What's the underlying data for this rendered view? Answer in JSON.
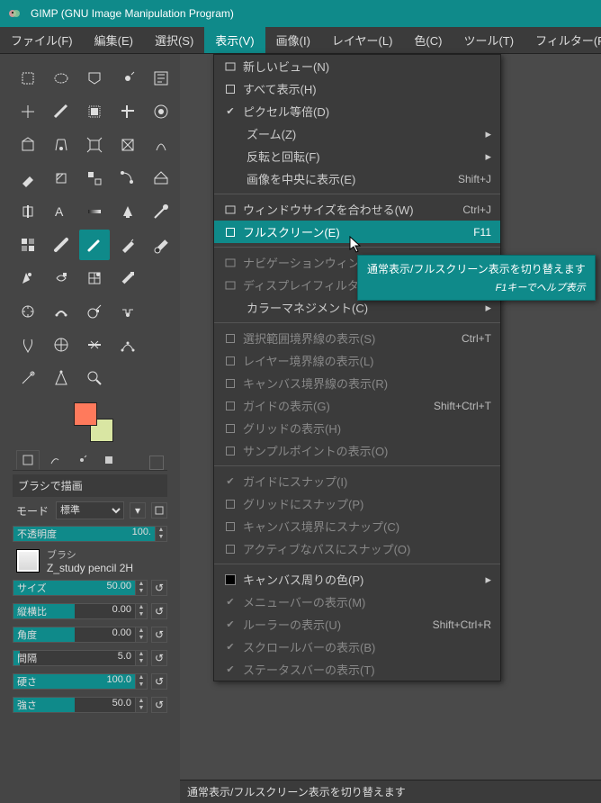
{
  "titlebar": {
    "title": "GIMP (GNU Image Manipulation Program)"
  },
  "menubar": {
    "items": [
      {
        "label": "ファイル(F)"
      },
      {
        "label": "編集(E)"
      },
      {
        "label": "選択(S)"
      },
      {
        "label": "表示(V)",
        "active": true
      },
      {
        "label": "画像(I)"
      },
      {
        "label": "レイヤー(L)"
      },
      {
        "label": "色(C)"
      },
      {
        "label": "ツール(T)"
      },
      {
        "label": "フィルター(R)"
      }
    ]
  },
  "view_menu": [
    {
      "t": "item",
      "label": "新しいビュー(N)",
      "icon": "window"
    },
    {
      "t": "item",
      "label": "すべて表示(H)",
      "chk": false
    },
    {
      "t": "item",
      "label": "ピクセル等倍(D)",
      "chk": true
    },
    {
      "t": "item",
      "label": "ズーム(Z)",
      "sub": true,
      "indent": true
    },
    {
      "t": "item",
      "label": "反転と回転(F)",
      "sub": true,
      "indent": true
    },
    {
      "t": "item",
      "label": "画像を中央に表示(E)",
      "accel": "Shift+J",
      "indent": true
    },
    {
      "t": "sep"
    },
    {
      "t": "item",
      "label": "ウィンドウサイズを合わせる(W)",
      "accel": "Ctrl+J",
      "icon": "window"
    },
    {
      "t": "item",
      "label": "フルスクリーン(E)",
      "accel": "F11",
      "chk": false,
      "highlight": true
    },
    {
      "t": "sep"
    },
    {
      "t": "item",
      "label": "ナビゲーションウィンドウ(V)",
      "icon": "compass",
      "dim": true
    },
    {
      "t": "item",
      "label": "ディスプレイフィルター(D)...",
      "icon": "filter",
      "dim": true
    },
    {
      "t": "item",
      "label": "カラーマネジメント(C)",
      "sub": true,
      "indent": true
    },
    {
      "t": "sep"
    },
    {
      "t": "item",
      "label": "選択範囲境界線の表示(S)",
      "accel": "Ctrl+T",
      "chk": false,
      "dim": true
    },
    {
      "t": "item",
      "label": "レイヤー境界線の表示(L)",
      "chk": false,
      "dim": true
    },
    {
      "t": "item",
      "label": "キャンバス境界線の表示(R)",
      "chk": false,
      "dim": true
    },
    {
      "t": "item",
      "label": "ガイドの表示(G)",
      "accel": "Shift+Ctrl+T",
      "chk": false,
      "dim": true
    },
    {
      "t": "item",
      "label": "グリッドの表示(H)",
      "chk": false,
      "dim": true
    },
    {
      "t": "item",
      "label": "サンプルポイントの表示(O)",
      "chk": false,
      "dim": true
    },
    {
      "t": "sep"
    },
    {
      "t": "item",
      "label": "ガイドにスナップ(I)",
      "chk": true,
      "dim": true
    },
    {
      "t": "item",
      "label": "グリッドにスナップ(P)",
      "chk": false,
      "dim": true
    },
    {
      "t": "item",
      "label": "キャンバス境界にスナップ(C)",
      "chk": false,
      "dim": true
    },
    {
      "t": "item",
      "label": "アクティブなパスにスナップ(O)",
      "chk": false,
      "dim": true
    },
    {
      "t": "sep"
    },
    {
      "t": "item",
      "label": "キャンバス周りの色(P)",
      "sub": true,
      "swatch": "#000"
    },
    {
      "t": "item",
      "label": "メニューバーの表示(M)",
      "chk": true,
      "dim": true
    },
    {
      "t": "item",
      "label": "ルーラーの表示(U)",
      "accel": "Shift+Ctrl+R",
      "chk": true,
      "dim": true
    },
    {
      "t": "item",
      "label": "スクロールバーの表示(B)",
      "chk": true,
      "dim": true
    },
    {
      "t": "item",
      "label": "ステータスバーの表示(T)",
      "chk": true,
      "dim": true
    }
  ],
  "tooltip": {
    "main": "通常表示/フルスクリーン表示を切り替えます",
    "sub": "F1キーでヘルプ表示"
  },
  "statusbar": {
    "text": "通常表示/フルスクリーン表示を切り替えます"
  },
  "tool_options": {
    "title": "ブラシで描画",
    "mode_label": "モード",
    "mode_value": "標準",
    "opacity_label": "不透明度",
    "opacity_value": "100.",
    "brush_label": "ブラシ",
    "brush_name": "Z_study pencil 2H",
    "size_label": "サイズ",
    "size_value": "50.00",
    "aspect_label": "縦横比",
    "aspect_value": "0.00",
    "angle_label": "角度",
    "angle_value": "0.00",
    "spacing_label": "間隔",
    "spacing_value": "5.0",
    "hardness_label": "硬さ",
    "hardness_value": "100.0",
    "force_label": "強さ",
    "force_value": "50.0"
  },
  "swatches": {
    "fg": "#ff7a5c",
    "bg": "#d9e6a3"
  }
}
